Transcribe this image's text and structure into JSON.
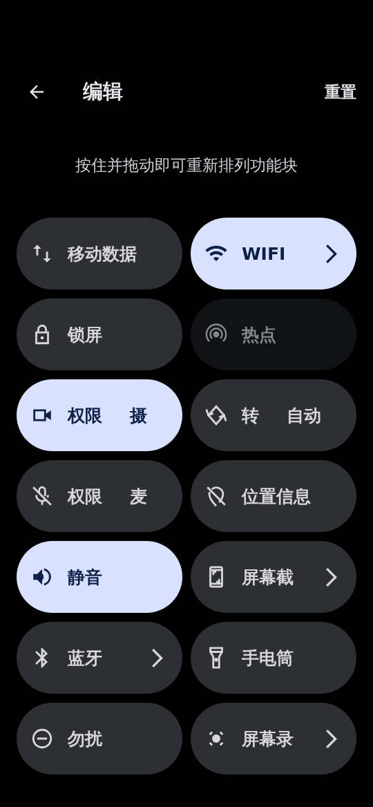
{
  "header": {
    "title": "编辑",
    "reset": "重置"
  },
  "hint": "按住并拖动即可重新排列功能块",
  "tiles": [
    {
      "label": [
        "移动数据"
      ],
      "on": false,
      "disabled": false,
      "chevron": false
    },
    {
      "label": [
        "WIFI"
      ],
      "on": true,
      "disabled": false,
      "chevron": true
    },
    {
      "label": [
        "锁屏"
      ],
      "on": false,
      "disabled": false,
      "chevron": false
    },
    {
      "label": [
        "热点"
      ],
      "on": false,
      "disabled": true,
      "chevron": false
    },
    {
      "label": [
        "权限",
        "摄"
      ],
      "on": true,
      "disabled": false,
      "chevron": false
    },
    {
      "label": [
        "转",
        "自动"
      ],
      "on": false,
      "disabled": false,
      "chevron": false
    },
    {
      "label": [
        "权限",
        "麦"
      ],
      "on": false,
      "disabled": false,
      "chevron": false
    },
    {
      "label": [
        "位置信息"
      ],
      "on": false,
      "disabled": false,
      "chevron": false
    },
    {
      "label": [
        "静音"
      ],
      "on": true,
      "disabled": false,
      "chevron": false
    },
    {
      "label": [
        "屏幕截"
      ],
      "on": false,
      "disabled": false,
      "chevron": true
    },
    {
      "label": [
        "蓝牙"
      ],
      "on": false,
      "disabled": false,
      "chevron": true
    },
    {
      "label": [
        "手电筒"
      ],
      "on": false,
      "disabled": false,
      "chevron": false
    },
    {
      "label": [
        "勿扰"
      ],
      "on": false,
      "disabled": false,
      "chevron": false
    },
    {
      "label": [
        "屏幕录"
      ],
      "on": false,
      "disabled": false,
      "chevron": true
    }
  ]
}
